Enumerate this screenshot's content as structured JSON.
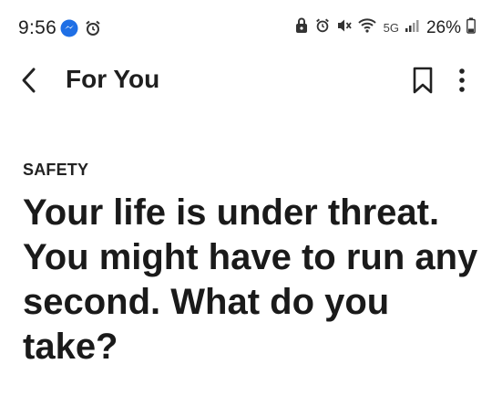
{
  "status_bar": {
    "time": "9:56",
    "network": "5G",
    "battery": "26%",
    "left_icons": [
      "messenger-icon",
      "alarm-icon"
    ],
    "right_icons": [
      "lock-app-icon",
      "alarm-icon",
      "mute-icon",
      "wifi-icon",
      "signal-icon",
      "battery-icon"
    ]
  },
  "app_bar": {
    "title": "For You"
  },
  "article": {
    "category": "SAFETY",
    "headline": "Your life is under threat. You might have to run any second. What do you take?"
  }
}
